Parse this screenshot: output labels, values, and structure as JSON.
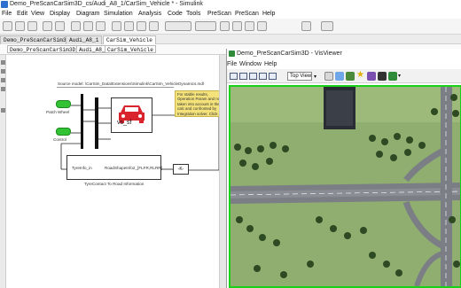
{
  "window": {
    "title": "Demo_PreScanCarSim3D_cs/Audi_A8_1/CarSim_Vehicle * - Simulink"
  },
  "menu": [
    "File",
    "Edit",
    "View",
    "Display",
    "Diagram",
    "Simulation",
    "Analysis",
    "Code",
    "Tools",
    "PreScan",
    "PreScan",
    "Help"
  ],
  "tabs": [
    {
      "label": "Demo_PreScanCarSim3D_cs"
    },
    {
      "label": "Audi_A8_1"
    },
    {
      "label": "CarSim_Vehicle"
    }
  ],
  "breadcrumb": [
    "Demo_PreScanCarSim3D_cs",
    "Audi_A8_1",
    "CarSim_Vehicle"
  ],
  "diagram": {
    "header_text": "Source model: \\CarSim_Data\\Extensions\\Simulink\\CarSim_VehicleDynamics.mdl",
    "inport_1": "Patch Wheel",
    "inport_2": "Control",
    "block_label": "vs_sf",
    "note_text": "For stable results, Operation Param and not taken into account in the calc and confronted by Integration solver. Click at registration for more detail.",
    "bottom_block_left": "TyreInfo_in",
    "bottom_block_right": "RoadShapeInfo2_[FLFR,RLRR]",
    "bottom_caption": "TyreContact To Road Information",
    "gain_label": "-K-"
  },
  "visviewer": {
    "title": "Demo_PreScanCarSim3D - VisViewer",
    "menu": [
      "File",
      "Window",
      "Help"
    ],
    "view_select": "Top View",
    "accent": "#19d119"
  }
}
